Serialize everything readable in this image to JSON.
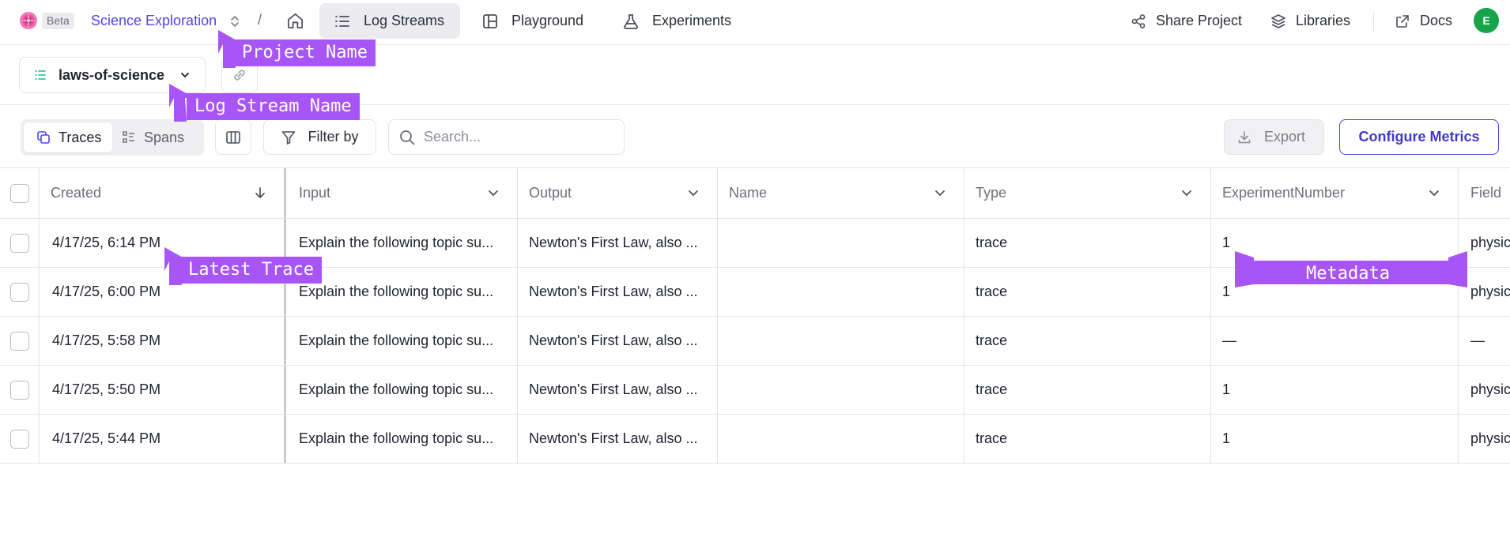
{
  "nav": {
    "beta": "Beta",
    "project": "Science Exploration",
    "separator": "/",
    "tabs": [
      {
        "label": "Log Streams",
        "icon": "list-icon",
        "active": true
      },
      {
        "label": "Playground",
        "icon": "layout-icon",
        "active": false
      },
      {
        "label": "Experiments",
        "icon": "flask-icon",
        "active": false
      }
    ],
    "share": "Share Project",
    "libraries": "Libraries",
    "docs": "Docs",
    "avatar": "E"
  },
  "stream": {
    "name": "laws-of-science"
  },
  "toolbar": {
    "traces": "Traces",
    "spans": "Spans",
    "filter": "Filter by",
    "search_placeholder": "Search...",
    "export": "Export",
    "configure": "Configure Metrics"
  },
  "table": {
    "columns": [
      "Created",
      "Input",
      "Output",
      "Name",
      "Type",
      "ExperimentNumber",
      "Field"
    ],
    "rows": [
      {
        "created": "4/17/25, 6:14 PM",
        "input": "Explain the following topic su...",
        "output": "Newton's First Law, also ...",
        "name": "",
        "type": "trace",
        "experiment": "1",
        "field": "physic"
      },
      {
        "created": "4/17/25, 6:00 PM",
        "input": "Explain the following topic su...",
        "output": "Newton's First Law, also ...",
        "name": "",
        "type": "trace",
        "experiment": "1",
        "field": "physic"
      },
      {
        "created": "4/17/25, 5:58 PM",
        "input": "Explain the following topic su...",
        "output": "Newton's First Law, also ...",
        "name": "",
        "type": "trace",
        "experiment": "—",
        "field": "—"
      },
      {
        "created": "4/17/25, 5:50 PM",
        "input": "Explain the following topic su...",
        "output": "Newton's First Law, also ...",
        "name": "",
        "type": "trace",
        "experiment": "1",
        "field": "physic"
      },
      {
        "created": "4/17/25, 5:44 PM",
        "input": "Explain the following topic su...",
        "output": "Newton's First Law, also ...",
        "name": "",
        "type": "trace",
        "experiment": "1",
        "field": "physic"
      }
    ]
  },
  "annotations": {
    "project_name": "Project Name",
    "log_stream_name": "Log Stream Name",
    "latest_trace": "Latest Trace",
    "metadata": "Metadata"
  },
  "colors": {
    "accent": "#4f46e5",
    "annotation": "#a855f7",
    "avatar": "#16a34a"
  }
}
